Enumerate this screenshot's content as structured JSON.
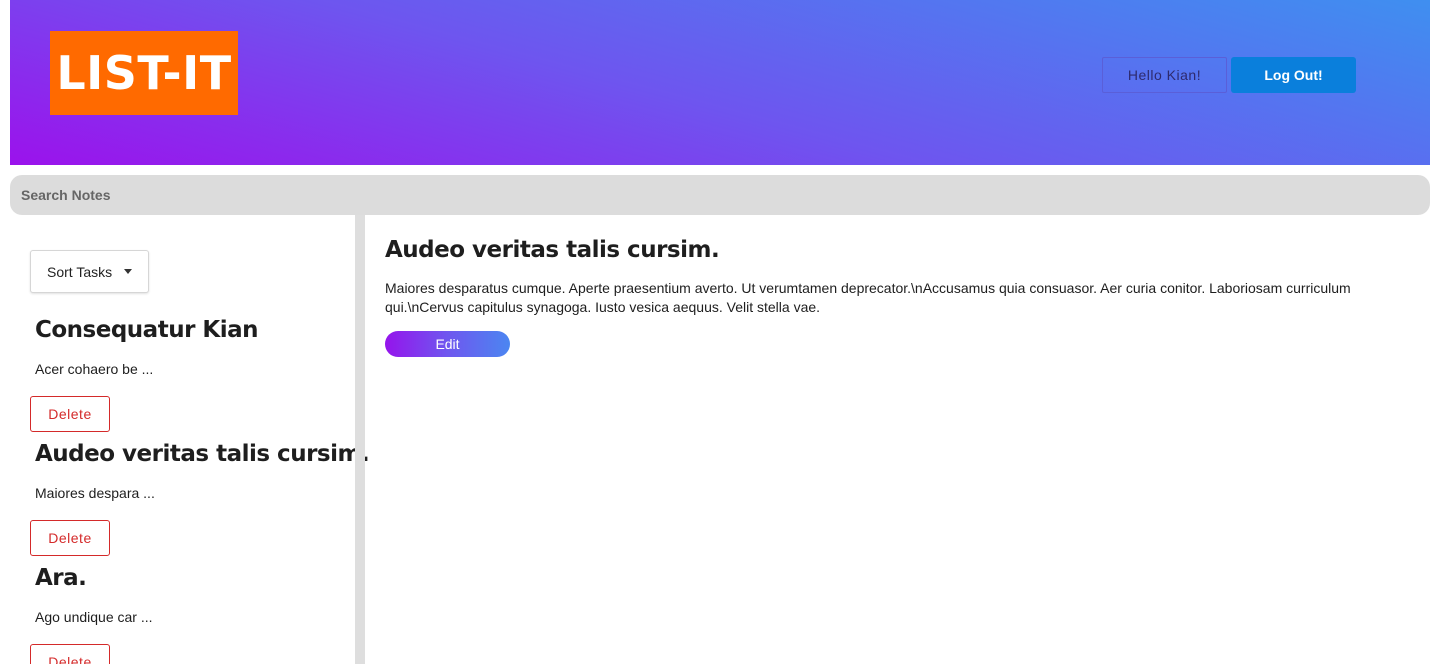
{
  "header": {
    "logo_text": "LIST-IT",
    "greeting": "Hello Kian!",
    "logout_label": "Log Out!"
  },
  "search": {
    "placeholder": "Search Notes"
  },
  "sidebar": {
    "sort_label": "Sort Tasks",
    "notes": [
      {
        "title": "Consequatur Kian",
        "snippet": "Acer cohaero be ...",
        "delete_label": "Delete"
      },
      {
        "title": "Audeo veritas talis cursim.",
        "snippet": "Maiores despara ...",
        "delete_label": "Delete"
      },
      {
        "title": "Ara.",
        "snippet": "Ago undique car ...",
        "delete_label": "Delete"
      }
    ]
  },
  "main": {
    "title": "Audeo veritas talis cursim.",
    "body": "Maiores desparatus cumque. Aperte praesentium averto. Ut verumtamen deprecator.\\nAccusamus quia consuasor. Aer curia conitor. Laboriosam curriculum qui.\\nCervus capitulus synagoga. Iusto vesica aequus. Velit stella vae.",
    "edit_label": "Edit"
  },
  "colors": {
    "logo_bg": "#ff6a00",
    "header_gradient_start": "#9b12ec",
    "header_gradient_end": "#3f8ff0",
    "logout_bg": "#0a7fdc",
    "delete_red": "#d42a2a",
    "search_bg": "#dcdcdc"
  }
}
